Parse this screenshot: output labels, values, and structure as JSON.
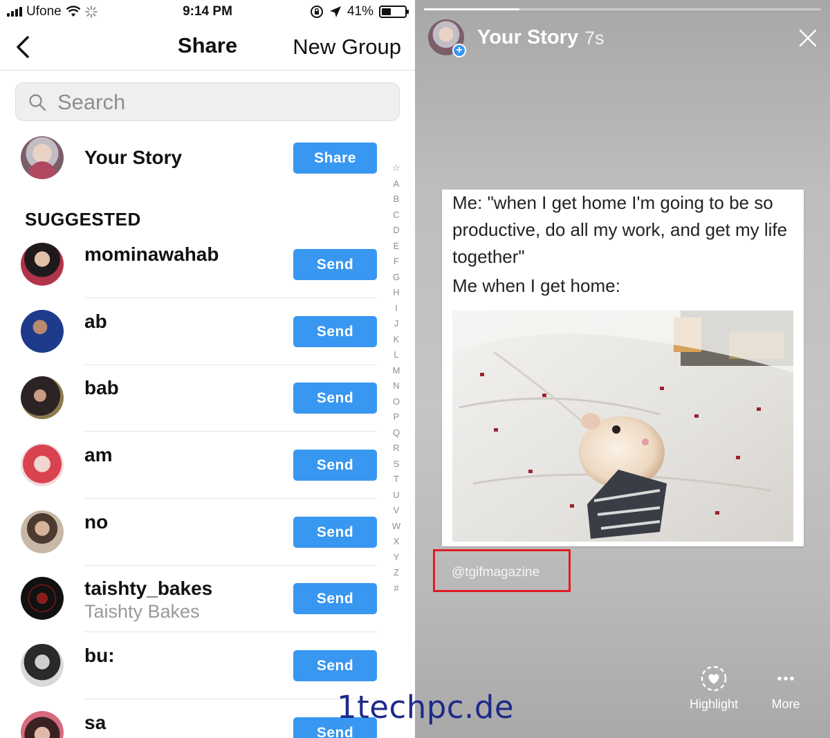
{
  "status_bar": {
    "carrier": "Ufone",
    "time": "9:14 PM",
    "battery_percent": "41%",
    "battery_level": 0.41
  },
  "nav": {
    "title": "Share",
    "new_group": "New Group"
  },
  "search": {
    "placeholder": "Search"
  },
  "your_story": {
    "name": "Your Story",
    "button": "Share"
  },
  "suggested_header": "SUGGESTED",
  "contacts": [
    {
      "username": "mominawahab",
      "fullname": "",
      "button": "Send"
    },
    {
      "username": "ab",
      "fullname": "",
      "button": "Send"
    },
    {
      "username": "bab",
      "fullname": "",
      "button": "Send"
    },
    {
      "username": "am",
      "fullname": "",
      "button": "Send"
    },
    {
      "username": "no",
      "fullname": "",
      "button": "Send"
    },
    {
      "username": "taishty_bakes",
      "fullname": "Taishty Bakes",
      "button": "Send"
    },
    {
      "username": "bu:",
      "fullname": "",
      "button": "Send"
    },
    {
      "username": "sa",
      "fullname": "",
      "button": "Send"
    }
  ],
  "index_letters": [
    "☆",
    "A",
    "B",
    "C",
    "D",
    "E",
    "F",
    "G",
    "H",
    "I",
    "J",
    "K",
    "L",
    "M",
    "N",
    "O",
    "P",
    "Q",
    "R",
    "S",
    "T",
    "U",
    "V",
    "W",
    "X",
    "Y",
    "Z",
    "#"
  ],
  "story_viewer": {
    "title": "Your Story",
    "elapsed": "7s",
    "progress": 0.24,
    "meme_line1": "Me: \"when I get home I'm going to be so productive, do all my work, and get my life together\"",
    "meme_line2": "Me when I get home:",
    "mention": "@tgifmagazine",
    "actions": [
      {
        "label": "Highlight",
        "icon": "heart-circle-icon"
      },
      {
        "label": "More",
        "icon": "more-dots-icon"
      }
    ]
  },
  "watermark": "1techpc.de",
  "colors": {
    "accent": "#3897f0",
    "highlight_box": "#e01b24"
  }
}
